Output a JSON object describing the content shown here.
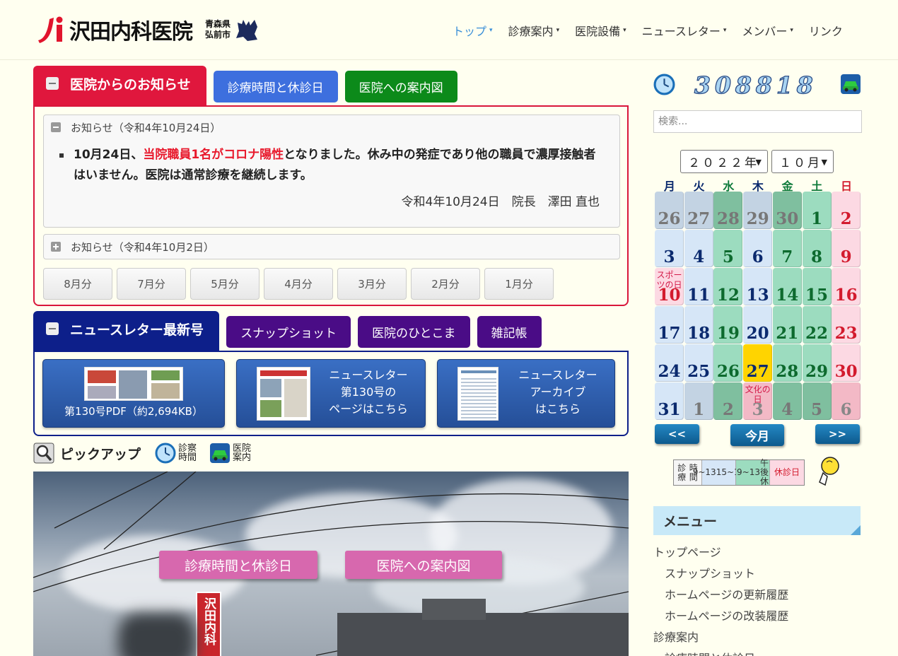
{
  "header": {
    "logo_name": "沢田内科医院",
    "logo_pref_line1": "青森県",
    "logo_pref_line2": "弘前市"
  },
  "nav": [
    {
      "label": "トップ",
      "caret": "▾"
    },
    {
      "label": "診療案内",
      "caret": "▾"
    },
    {
      "label": "医院設備",
      "caret": "▾"
    },
    {
      "label": "ニュースレター",
      "caret": "▾"
    },
    {
      "label": "メンバー",
      "caret": "▾"
    },
    {
      "label": "リンク",
      "caret": ""
    }
  ],
  "notice_tabs": {
    "main": "医院からのお知らせ",
    "tab1": "診療時間と休診日",
    "tab2": "医院への案内図"
  },
  "notice1": {
    "title": "お知らせ（令和4年10月24日）",
    "part1": "10月24日、",
    "part2": "当院職員1名がコロナ陽性",
    "part3": "となりました。休み中の発症であり他の職員で濃厚接触者はいません。医院は通常診療を継続します。",
    "sign": "令和4年10月24日　院長　澤田 直也"
  },
  "notice2": {
    "title": "お知らせ（令和4年10月2日）"
  },
  "months": [
    "8月分",
    "7月分",
    "5月分",
    "4月分",
    "3月分",
    "2月分",
    "1月分"
  ],
  "nl_tabs": {
    "main": "ニュースレター最新号",
    "tab1": "スナップショット",
    "tab2": "医院のひとこま",
    "tab3": "雑記帳"
  },
  "nl_buttons": {
    "pdf": "第130号PDF（約2,694KB）",
    "page_l1": "ニュースレター",
    "page_l2": "第130号の",
    "page_l3": "ページはこちら",
    "arch_l1": "ニュースレター",
    "arch_l2": "アーカイブ",
    "arch_l3": "はこちら"
  },
  "pickup": {
    "label": "ピックアップ",
    "clock1": "診察",
    "clock2": "時間",
    "car1": "医院",
    "car2": "案内"
  },
  "photo": {
    "btn1": "診療時間と休診日",
    "btn2": "医院への案内図",
    "sign_text": "沢田内科"
  },
  "counter": {
    "value": "308818"
  },
  "search": {
    "placeholder": "検索..."
  },
  "calendar": {
    "year": "２０２２年",
    "month": "１０月",
    "dow": [
      "月",
      "火",
      "水",
      "木",
      "金",
      "土",
      "日"
    ],
    "today_label": "今月",
    "prev": "<<",
    "next": ">>",
    "weeks": [
      [
        "26",
        "27",
        "28",
        "29",
        "30",
        "1",
        "2"
      ],
      [
        "3",
        "4",
        "5",
        "6",
        "7",
        "8",
        "9"
      ],
      [
        "10",
        "11",
        "12",
        "13",
        "14",
        "15",
        "16"
      ],
      [
        "17",
        "18",
        "19",
        "20",
        "21",
        "22",
        "23"
      ],
      [
        "24",
        "25",
        "26",
        "27",
        "28",
        "29",
        "30"
      ],
      [
        "31",
        "1",
        "2",
        "3",
        "4",
        "5",
        "6"
      ]
    ],
    "notes": {
      "sports": "スポーツの日",
      "culture": "文化の日"
    },
    "colors": {
      "weekday": "#d6e6f7",
      "half": "#9cdcbf",
      "holiday": "#fcd9e3",
      "out": "#c3d3e3",
      "out_half": "#7fbf9f",
      "out_hol": "#f3b9c6",
      "today": "#ffd400"
    }
  },
  "legend": {
    "label1": "診療",
    "label2": "時間",
    "a1": "9~13",
    "a2": "15~18",
    "b1": "9~13",
    "b2": "午後休",
    "c": "休診日"
  },
  "menu": {
    "title": "メニュー",
    "items": [
      {
        "label": "トップページ",
        "sub": false
      },
      {
        "label": "スナップショット",
        "sub": true
      },
      {
        "label": "ホームページの更新履歴",
        "sub": true
      },
      {
        "label": "ホームページの改装履歴",
        "sub": true
      },
      {
        "label": "診療案内",
        "sub": false
      },
      {
        "label": "診療時間と休診日",
        "sub": true
      }
    ]
  }
}
